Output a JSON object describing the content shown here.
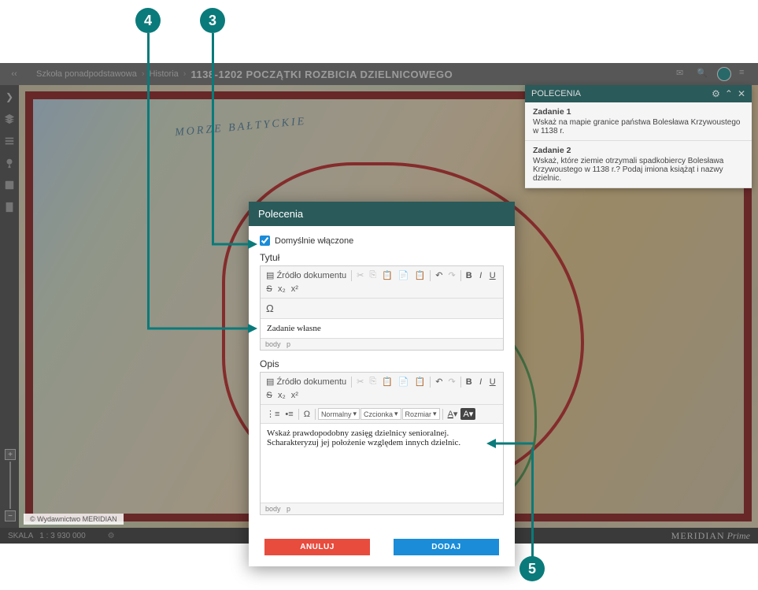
{
  "callouts": {
    "c3": "3",
    "c4": "4",
    "c5": "5"
  },
  "breadcrumb": {
    "level1": "Szkoła ponadpodstawowa",
    "level2": "Historia",
    "current": "1138-1202 POCZĄTKI ROZBICIA DZIELNICOWEGO"
  },
  "map": {
    "sea": "MORZE BAŁTYCKIE",
    "copyright": "© Wydawnictwo MERIDIAN"
  },
  "footer": {
    "scale_label": "SKALA",
    "scale_value": "1 : 3 930 000",
    "brand_a": "MERIDIAN",
    "brand_b": "Prime"
  },
  "side_panel": {
    "header": "POLECENIA",
    "tasks": [
      {
        "title": "Zadanie 1",
        "body": "Wskaż na mapie granice państwa Bolesława Krzywoustego w 1138 r."
      },
      {
        "title": "Zadanie 2",
        "body": "Wskaż, które ziemie otrzymali spadkobiercy Bolesława Krzywoustego w 1138 r.? Podaj imiona książąt i nazwy dzielnic."
      }
    ]
  },
  "modal": {
    "header": "Polecenia",
    "checkbox_label": "Domyślnie włączone",
    "title_label": "Tytuł",
    "desc_label": "Opis",
    "title_value": "Zadanie własne",
    "desc_value": "Wskaż prawdopodobny zasięg dzielnicy senioralnej. Scharakteryzuj jej położenie względem innych dzielnic.",
    "source_btn": "Źródło dokumentu",
    "path_body": "body",
    "path_p": "p",
    "dropdown_style": "Normalny",
    "dropdown_font": "Czcionka",
    "dropdown_size": "Rozmiar",
    "btn_cancel": "ANULUJ",
    "btn_add": "DODAJ"
  }
}
